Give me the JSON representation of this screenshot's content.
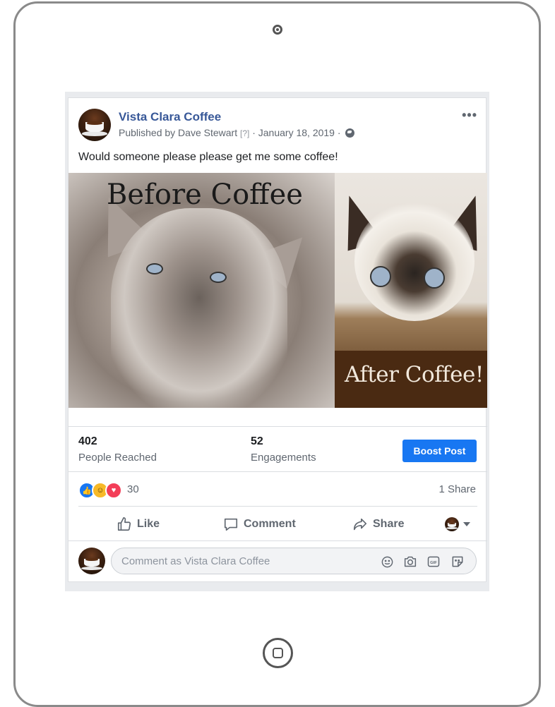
{
  "post": {
    "page_name": "Vista Clara Coffee",
    "published_by": "Published by Dave Stewart",
    "help_marker": "[?]",
    "date": "· January 18, 2019 ·",
    "text": "Would someone please please get me some coffee!",
    "more_label": "•••",
    "image_before_caption": "Before Coffee",
    "image_after_caption": "After Coffee!"
  },
  "insights": {
    "reached_count": "402",
    "reached_label": "People Reached",
    "engagements_count": "52",
    "engagements_label": "Engagements",
    "boost_label": "Boost Post"
  },
  "reactions": {
    "count": "30",
    "shares": "1 Share",
    "types": [
      "like-icon",
      "haha-icon",
      "love-icon"
    ]
  },
  "actions": {
    "like": "Like",
    "comment": "Comment",
    "share": "Share"
  },
  "composer": {
    "placeholder": "Comment as Vista Clara Coffee",
    "icons": [
      "emoji-icon",
      "camera-icon",
      "gif-icon",
      "sticker-icon"
    ]
  },
  "colors": {
    "brand_link": "#385898",
    "button_blue": "#1877f2",
    "text_secondary": "#606770"
  }
}
